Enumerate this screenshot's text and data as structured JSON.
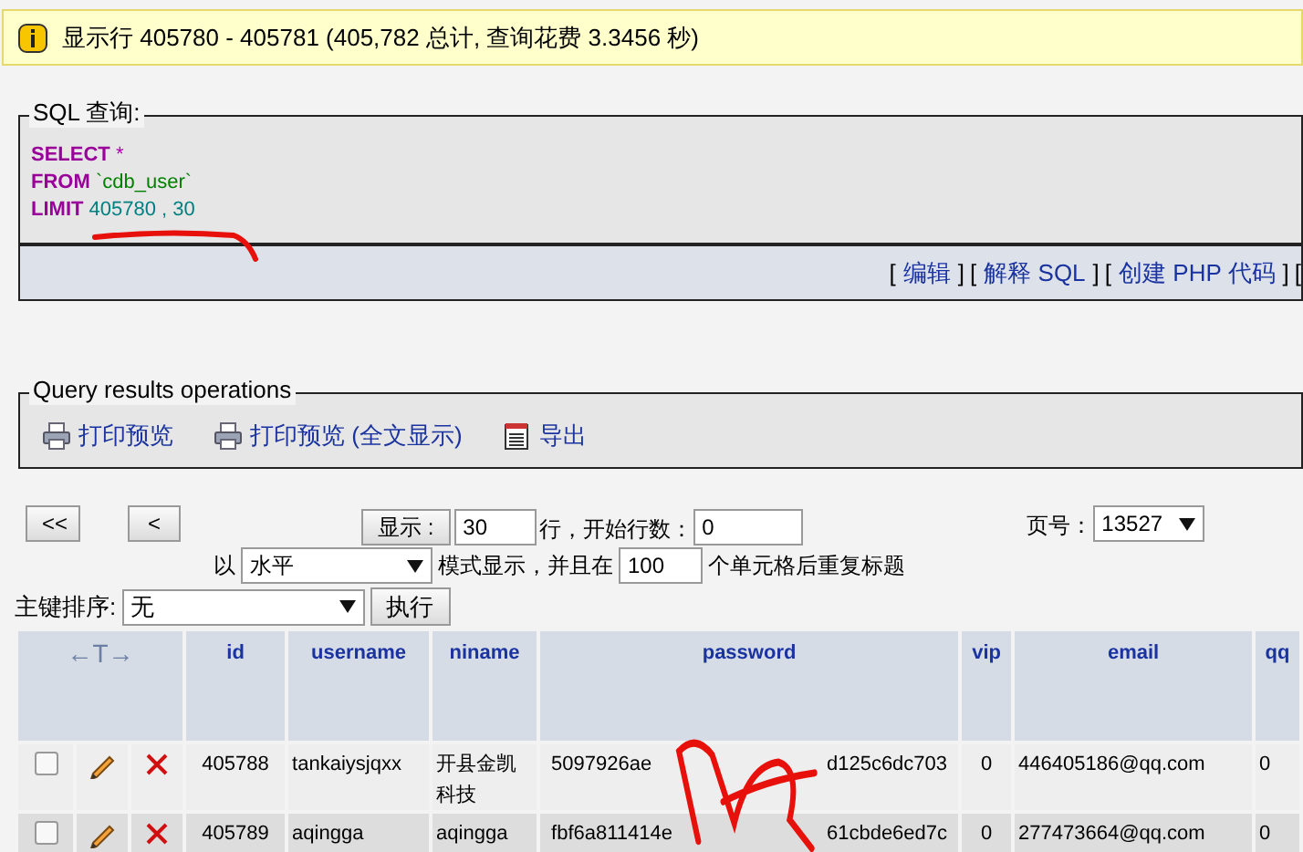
{
  "message": {
    "text": "显示行 405780 - 405781 (405,782 总计, 查询花费 3.3456 秒)"
  },
  "sql": {
    "legend": "SQL 查询:",
    "lines": [
      {
        "keyword": "SELECT",
        "value": "*",
        "kind": "symbol"
      },
      {
        "keyword": "FROM",
        "value": "`cdb_user`",
        "kind": "identifier"
      },
      {
        "keyword": "LIMIT",
        "value": "405780 , 30",
        "kind": "number"
      }
    ],
    "links": [
      {
        "open": "[",
        "label": "编辑",
        "close": "]"
      },
      {
        "open": "[",
        "label": "解释 SQL",
        "close": "]"
      },
      {
        "open": "[",
        "label": "创建 PHP 代码",
        "close": "]"
      }
    ],
    "trailing": "["
  },
  "operations": {
    "legend": "Query results operations",
    "items": [
      {
        "label": "打印预览",
        "kind": "print"
      },
      {
        "label": "打印预览 (全文显示)",
        "kind": "print"
      },
      {
        "label": "导出",
        "kind": "export"
      }
    ]
  },
  "nav": {
    "first": "<<",
    "prev": "<",
    "show_button": "显示 :",
    "rows": "30",
    "rows_label": "行，开始行数：",
    "start": "0",
    "page_label": "页号：",
    "page": "13527",
    "mode_prefix": "以",
    "mode": "水平",
    "mode_label": "模式显示，并且在",
    "repeat": "100",
    "repeat_label": "个单元格后重复标题",
    "sort_label": "主键排序:",
    "sort": "无",
    "go": "执行"
  },
  "table": {
    "sort_handle": "←T→",
    "columns": [
      "id",
      "username",
      "niname",
      "password",
      "vip",
      "email",
      "qq"
    ],
    "rows": [
      {
        "checked": false,
        "highlighted": false,
        "cells": [
          "405788",
          "tankaiysjqxx",
          "开县金凯科技",
          [
            "5097926ae",
            "d125c6dc703"
          ],
          "0",
          "446405186@qq.com",
          "0"
        ]
      },
      {
        "checked": false,
        "highlighted": true,
        "cells": [
          "405789",
          "aqingga",
          "aqingga",
          [
            "fbf6a811414e",
            "61cbde6ed7c"
          ],
          "0",
          "277473664@qq.com",
          "0"
        ]
      }
    ]
  }
}
